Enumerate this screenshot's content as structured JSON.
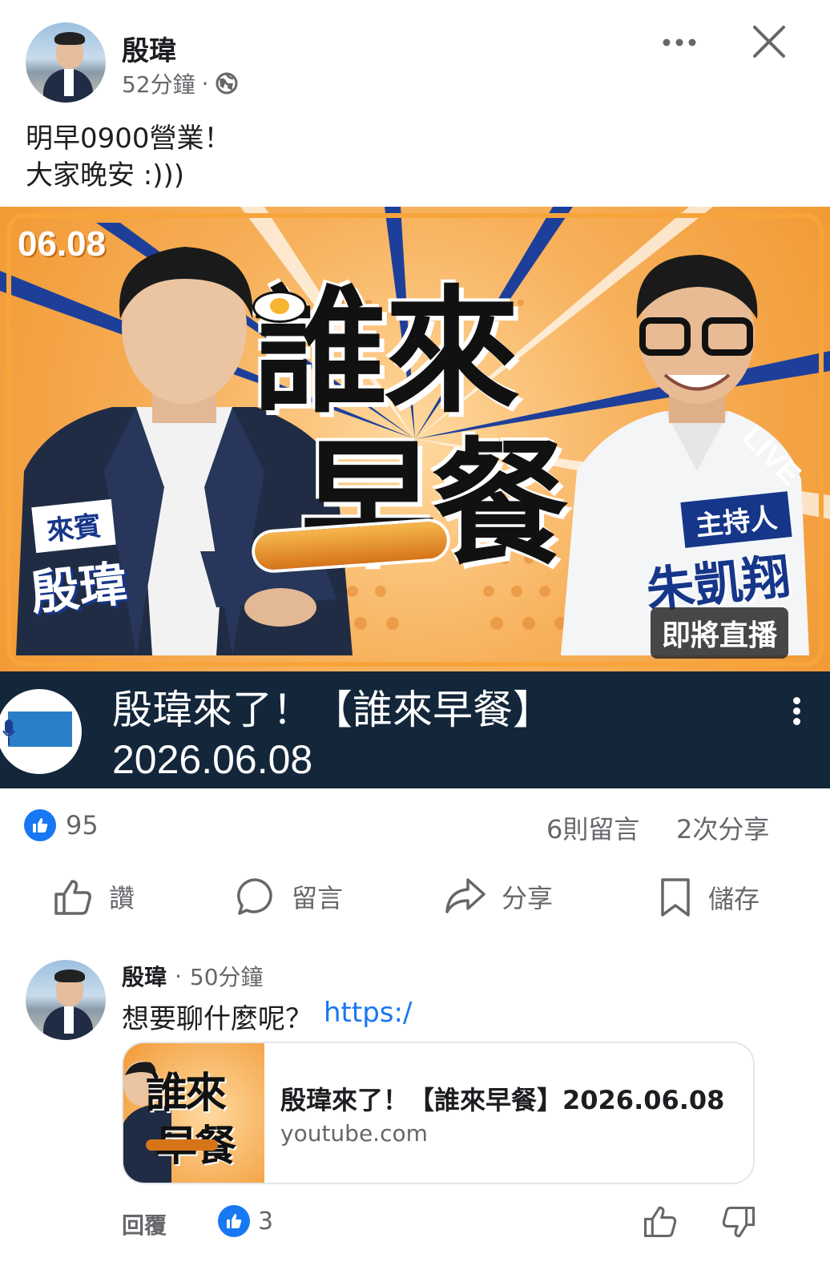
{
  "post": {
    "author": "殷瑋",
    "time": "52分鐘",
    "time_sep": "·",
    "text_line1": "明早0900營業！",
    "text_line2": "大家晚安 :)))"
  },
  "video": {
    "thumb_date": "06.08",
    "thumb_title_line1": "誰來",
    "thumb_title_line2": "早餐",
    "guest_badge": "來賓",
    "guest_name": "殷瑋",
    "host_badge": "主持人",
    "host_name": "朱凱翔",
    "live_soon": "即將直播",
    "live_tag": "LIVE",
    "title": "殷瑋來了！【誰來早餐】",
    "date": "2026.06.08"
  },
  "stats": {
    "likes": "95",
    "comments": "6則留言",
    "shares": "2次分享"
  },
  "actions": {
    "like": "讚",
    "comment": "留言",
    "share": "分享",
    "save": "儲存"
  },
  "comment": {
    "author": "殷瑋",
    "sep": "·",
    "time": "50分鐘",
    "text": "想要聊什麼呢？",
    "link": "https:/",
    "card_title": "殷瑋來了！【誰來早餐】2026.06.08",
    "card_domain": "youtube.com",
    "card_thumb_text1": "誰來",
    "card_thumb_text2": "早餐",
    "reply": "回覆",
    "reactions": "3"
  },
  "colors": {
    "accent": "#1877f2",
    "channel_bar": "#13263a",
    "muted": "#65676b"
  }
}
